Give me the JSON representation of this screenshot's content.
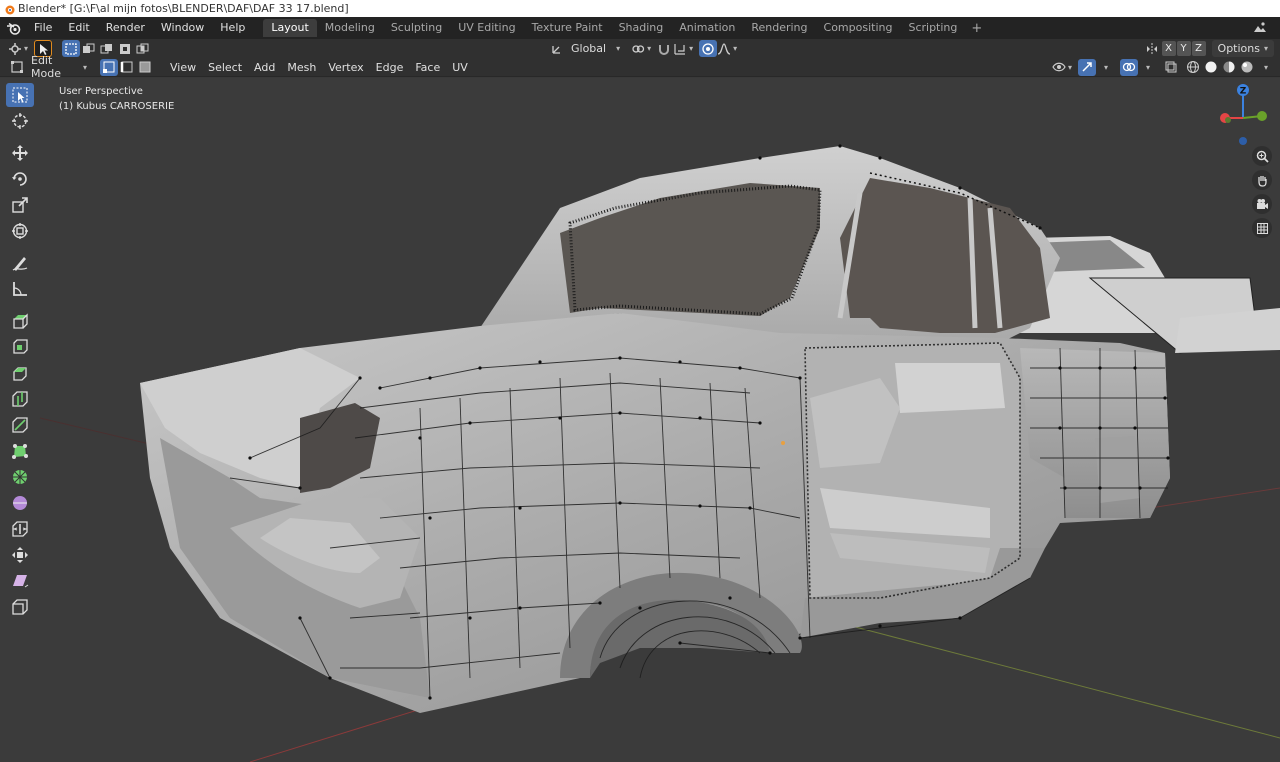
{
  "window": {
    "title": "Blender* [G:\\F\\al mijn fotos\\BLENDER\\DAF\\DAF 33 17.blend]"
  },
  "menus": [
    "File",
    "Edit",
    "Render",
    "Window",
    "Help"
  ],
  "workspaces": [
    {
      "label": "Layout",
      "active": true
    },
    {
      "label": "Modeling",
      "active": false
    },
    {
      "label": "Sculpting",
      "active": false
    },
    {
      "label": "UV Editing",
      "active": false
    },
    {
      "label": "Texture Paint",
      "active": false
    },
    {
      "label": "Shading",
      "active": false
    },
    {
      "label": "Animation",
      "active": false
    },
    {
      "label": "Rendering",
      "active": false
    },
    {
      "label": "Compositing",
      "active": false
    },
    {
      "label": "Scripting",
      "active": false
    }
  ],
  "header": {
    "transform_orientation": "Global",
    "axis_x": "X",
    "axis_y": "Y",
    "axis_z": "Z",
    "options_label": "Options",
    "mode": "Edit Mode",
    "edit_menus": [
      "View",
      "Select",
      "Add",
      "Mesh",
      "Vertex",
      "Edge",
      "Face",
      "UV"
    ]
  },
  "viewport": {
    "perspective_label": "User Perspective",
    "object_label": "(1) Kubus CARROSERIE",
    "gizmo_z": "Z"
  },
  "colors": {
    "accent": "#4772b3",
    "axis_x": "#e44545",
    "axis_y": "#6aa12a",
    "axis_z": "#3b82e0"
  }
}
